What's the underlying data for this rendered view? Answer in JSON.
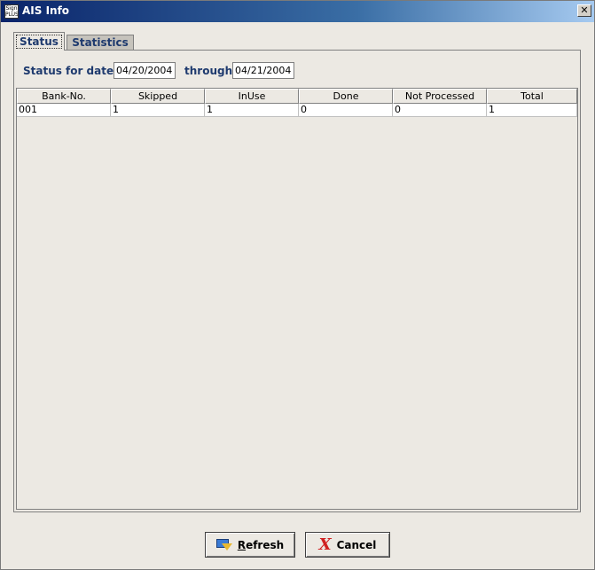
{
  "window": {
    "title": "AIS Info",
    "logo_text": "Sign PLUS",
    "close_glyph": "✕"
  },
  "tabs": [
    {
      "label": "Status",
      "active": true
    },
    {
      "label": "Statistics",
      "active": false
    }
  ],
  "filter": {
    "status_label": "Status",
    "for_date_label": "for date",
    "from_date": "04/20/2004",
    "through_label": "through",
    "to_date": "04/21/2004"
  },
  "table": {
    "columns": [
      "Bank-No.",
      "Skipped",
      "InUse",
      "Done",
      "Not Processed",
      "Total"
    ],
    "rows": [
      [
        "001",
        "1",
        "1",
        "0",
        "0",
        "1"
      ]
    ]
  },
  "buttons": {
    "refresh": {
      "label": "Refresh",
      "icon": "refresh-icon"
    },
    "cancel": {
      "label": "Cancel",
      "icon": "cancel-x-icon"
    }
  },
  "colors": {
    "accent_text": "#1E3A6E",
    "title_bar": "#0A246A"
  }
}
